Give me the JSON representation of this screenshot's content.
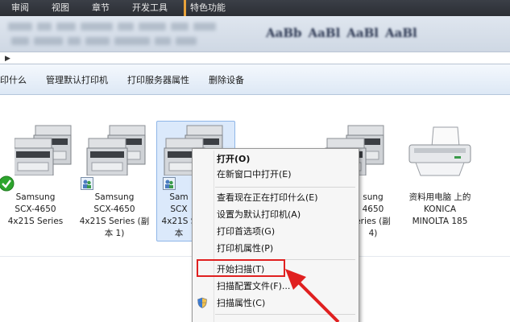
{
  "ribbon": {
    "tabs": [
      "审阅",
      "视图",
      "章节",
      "开发工具",
      "特色功能"
    ],
    "style_samples": [
      "AaBb",
      "AaBl",
      "AaBl",
      "AaBl"
    ]
  },
  "command_bar": {
    "items": [
      "印什么",
      "管理默认打印机",
      "打印服务器属性",
      "删除设备"
    ]
  },
  "devices": [
    {
      "line1": "Samsung",
      "line2": "SCX-4650",
      "line3": "4x21S Series",
      "line4": "",
      "status": "default"
    },
    {
      "line1": "Samsung",
      "line2": "SCX-4650",
      "line3": "4x21S Series (副",
      "line4": "本 1)",
      "status": "shared"
    },
    {
      "line1": "Sam",
      "line2": "SCX",
      "line3": "4x21S S",
      "line4": "本",
      "status": "shared"
    },
    {
      "line1": "sung",
      "line2": "4650",
      "line3": "eries (副",
      "line4": "4)",
      "status": "none"
    },
    {
      "line1": "资料用电脑 上的",
      "line2": "KONICA",
      "line3": "MINOLTA 185",
      "line4": "",
      "status": "none"
    }
  ],
  "context_menu": {
    "items": [
      {
        "label": "打开(O)",
        "bold": true
      },
      {
        "label": "在新窗口中打开(E)",
        "bold": false
      },
      {
        "label": "查看现在正在打印什么(E)",
        "bold": false
      },
      {
        "label": "设置为默认打印机(A)",
        "bold": false
      },
      {
        "label": "打印首选项(G)",
        "bold": false
      },
      {
        "label": "打印机属性(P)",
        "bold": false
      },
      {
        "label": "开始扫描(T)",
        "bold": false
      },
      {
        "label": "扫描配置文件(F)...",
        "bold": false
      },
      {
        "label": "扫描属性(C)",
        "bold": false
      }
    ]
  },
  "colors": {
    "highlight": "#e02020",
    "selection": "#dbe9fb",
    "default_check": "#2da52d"
  }
}
